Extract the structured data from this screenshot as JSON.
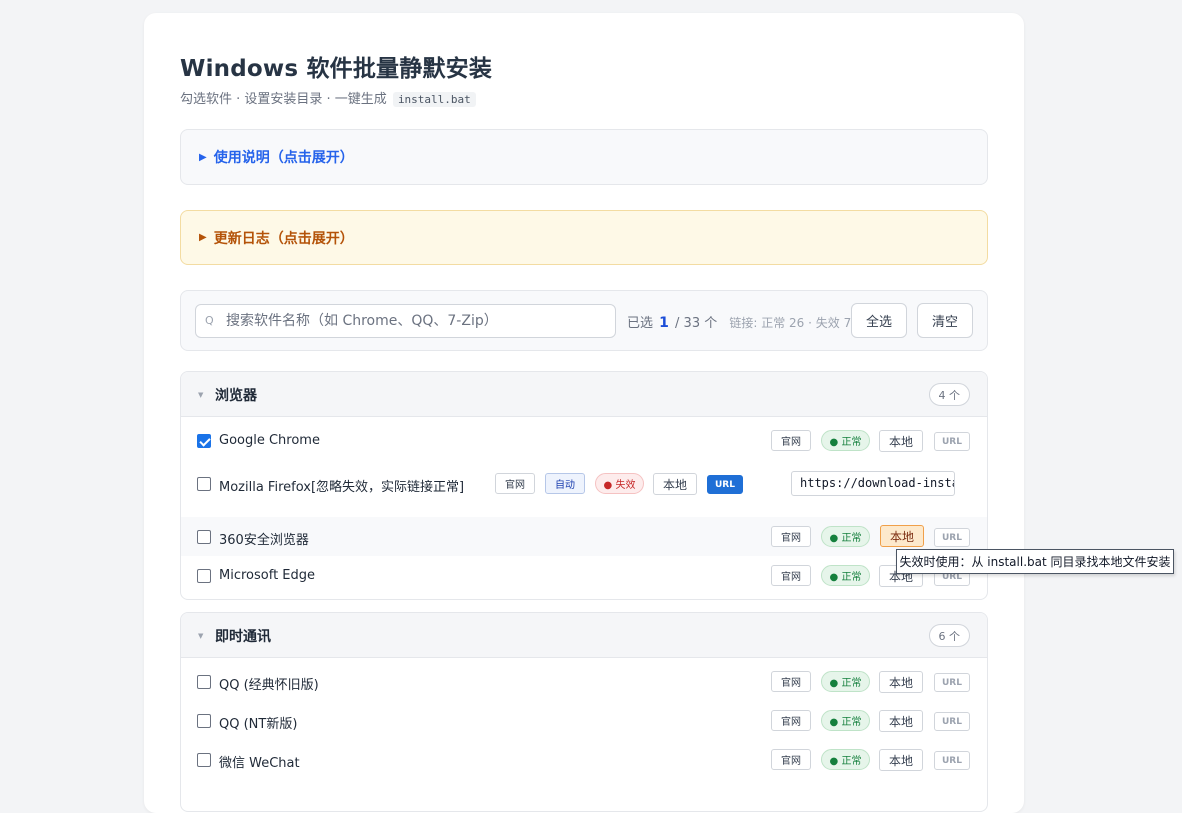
{
  "header": {
    "title": "Windows 软件批量静默安装",
    "subtitle": "勾选软件 · 设置安装目录 · 一键生成",
    "subtitle_code": "install.bat"
  },
  "panels": {
    "help": "使用说明（点击展开）",
    "changelog": "更新日志（点击展开）",
    "triangle": "▶"
  },
  "toolbar": {
    "search_placeholder": "搜索软件名称（如 Chrome、QQ、7-Zip）",
    "search_icon": "Q",
    "selected_prefix": "已选",
    "selected_count": "1",
    "selected_total": "/ 33 个",
    "link_stats": "链接: 正常 26 · 失效 7",
    "select_all": "全选",
    "clear": "清空"
  },
  "groups": [
    {
      "name": "浏览器",
      "count": "4 个",
      "items": [
        {
          "name": "Google Chrome",
          "checked": true,
          "site": "官网",
          "status": "● 正常",
          "local": "本地",
          "url": "URL"
        },
        {
          "name": "Mozilla Firefox[忽略失效，实际链接正常]",
          "checked": false,
          "site": "官网",
          "auto": "自动",
          "status": "● 失效",
          "local": "本地",
          "url": "URL",
          "url_value": "https://download-insta"
        },
        {
          "name": "360安全浏览器",
          "checked": false,
          "site": "官网",
          "status": "● 正常",
          "local": "本地",
          "url": "URL"
        },
        {
          "name": "Microsoft Edge",
          "checked": false,
          "site": "官网",
          "status": "● 正常",
          "local": "本地",
          "url": "URL"
        }
      ]
    },
    {
      "name": "即时通讯",
      "count": "6 个",
      "items": [
        {
          "name": "QQ (经典怀旧版)",
          "checked": false,
          "site": "官网",
          "status": "● 正常",
          "local": "本地",
          "url": "URL"
        },
        {
          "name": "QQ (NT新版)",
          "checked": false,
          "site": "官网",
          "status": "● 正常",
          "local": "本地",
          "url": "URL"
        },
        {
          "name": "微信 WeChat",
          "checked": false,
          "site": "官网",
          "status": "● 正常",
          "local": "本地",
          "url": "URL"
        }
      ]
    }
  ],
  "tooltip": "失效时使用：从 install.bat 同目录找本地文件安装",
  "icons": {
    "caret": "caret-down-icon",
    "search": "search-icon",
    "check": "checkmark-icon"
  },
  "colors": {
    "accent": "#1a73e8",
    "ok": "#15803d",
    "fail": "#c62828",
    "changelog": "#b45309"
  }
}
